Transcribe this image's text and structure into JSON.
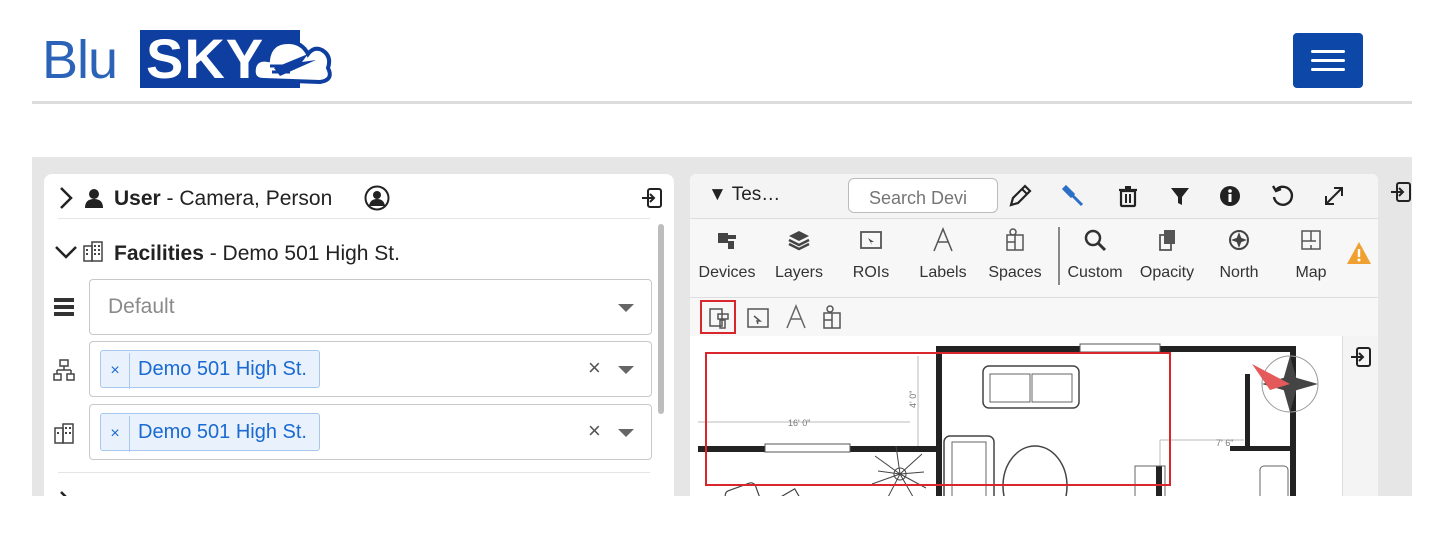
{
  "header": {
    "logo_blu": "Blu",
    "logo_sky": "SKY",
    "accent": "#0d47a8"
  },
  "left": {
    "user_label": "User",
    "user_value": " - Camera, Person",
    "facilities_label": "Facilities",
    "facilities_value": " - Demo 501 High St.",
    "layer_select": {
      "placeholder": "Default"
    },
    "site_select": {
      "tag": "Demo 501 High St.",
      "tag_remove": "×",
      "clear": "×"
    },
    "building_select": {
      "tag": "Demo 501 High St.",
      "tag_remove": "×",
      "clear": "×"
    }
  },
  "right": {
    "title": "▼ Tes…",
    "search_placeholder": "Search Devi",
    "ribbon": [
      "Devices",
      "Layers",
      "ROIs",
      "Labels",
      "Spaces",
      "Custom",
      "Opacity",
      "North",
      "Map"
    ],
    "plan_dims": [
      "16' 0\"",
      "4' 0\"",
      "7' 6\""
    ],
    "highlight_color": "#d9262c"
  }
}
